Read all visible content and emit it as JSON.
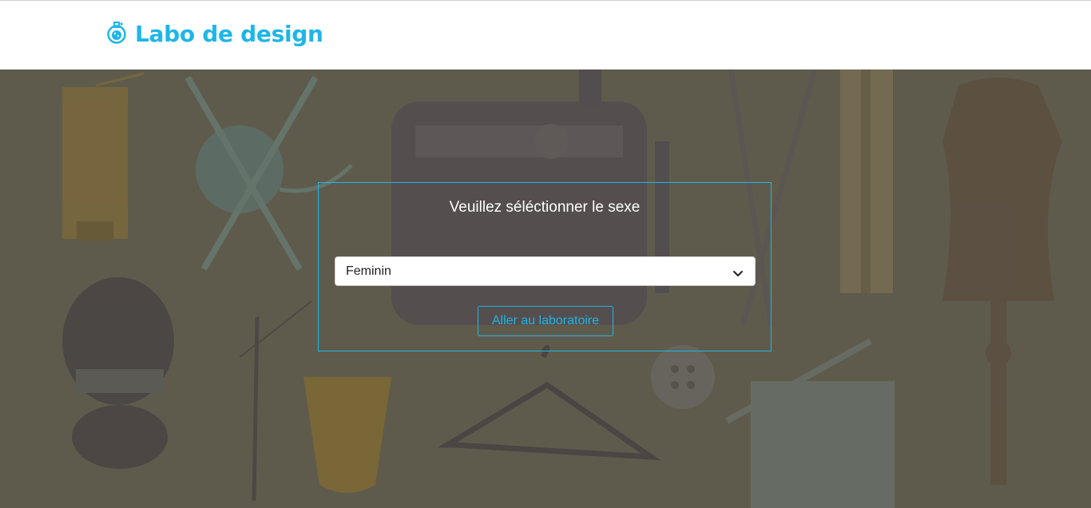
{
  "brand": {
    "name": "Labo de design",
    "icon": "flask-icon"
  },
  "colors": {
    "accent": "#1eb6e8",
    "hero_bg": "#5f5b4c"
  },
  "panel": {
    "title": "Veuillez séléctionner le sexe",
    "select": {
      "selected": "Feminin",
      "icon": "chevron-down-icon"
    },
    "button_label": "Aller au laboratoire"
  }
}
